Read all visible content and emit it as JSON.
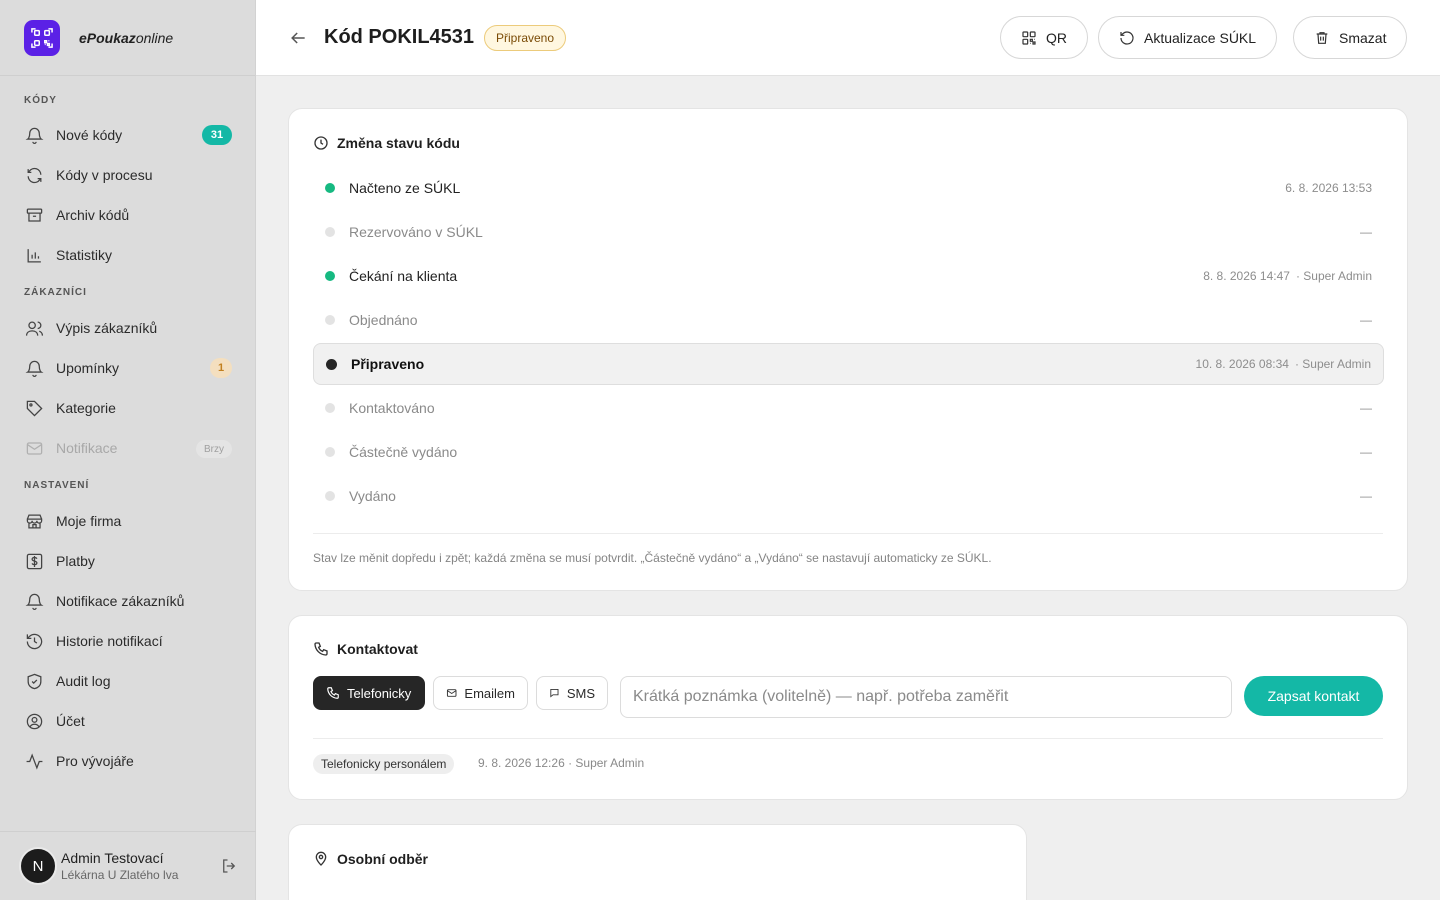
{
  "brand": {
    "name_bold": "ePoukaz",
    "name_rest": "online",
    "icon": "qr-code-icon",
    "color": "#5b21e6"
  },
  "sidebar": {
    "sections": [
      {
        "title": "KÓDY",
        "items": [
          {
            "label": "Nové kódy",
            "icon": "bell-icon",
            "badge": "31"
          },
          {
            "label": "Kódy v procesu",
            "icon": "refresh-icon"
          },
          {
            "label": "Archiv kódů",
            "icon": "archive-icon"
          },
          {
            "label": "Statistiky",
            "icon": "chart-icon"
          }
        ]
      },
      {
        "title": "ZÁKAZNÍCI",
        "items": [
          {
            "label": "Výpis zákazníků",
            "icon": "users-icon"
          },
          {
            "label": "Upomínky",
            "icon": "bell-icon",
            "badge": "1"
          },
          {
            "label": "Kategorie",
            "icon": "tag-icon"
          },
          {
            "label": "Notifikace",
            "icon": "mail-icon",
            "badge": "Brzy",
            "disabled": true
          }
        ]
      },
      {
        "title": "NASTAVENÍ",
        "items": [
          {
            "label": "Moje firma",
            "icon": "store-icon"
          },
          {
            "label": "Platby",
            "icon": "dollar-icon"
          },
          {
            "label": "Notifikace zákazníků",
            "icon": "bell-icon"
          },
          {
            "label": "Historie notifikací",
            "icon": "history-icon"
          },
          {
            "label": "Audit log",
            "icon": "shield-icon"
          },
          {
            "label": "Účet",
            "icon": "user-circle-icon"
          },
          {
            "label": "Pro vývojáře",
            "icon": "activity-icon"
          }
        ]
      }
    ]
  },
  "user": {
    "initial": "N",
    "name": "Admin Testovací",
    "pharmacy": "Lékárna U Zlatého lva"
  },
  "header": {
    "title": "Kód POKIL4531",
    "status": "Připraveno",
    "buttons": {
      "qr": "QR",
      "update": "Aktualizace SÚKL",
      "delete": "Smazat"
    }
  },
  "status_card": {
    "title": "Změna stavu kódu",
    "rows": [
      {
        "label": "Načteno ze SÚKL",
        "state": "done",
        "date": "6. 8. 2026 13:53",
        "by": ""
      },
      {
        "label": "Rezervováno v SÚKL",
        "state": "todo",
        "date": "—",
        "by": ""
      },
      {
        "label": "Čekání na klienta",
        "state": "done",
        "date": "8. 8. 2026 14:47",
        "by": "· Super Admin"
      },
      {
        "label": "Objednáno",
        "state": "todo",
        "date": "—",
        "by": ""
      },
      {
        "label": "Připraveno",
        "state": "current",
        "date": "10. 8. 2026 08:34",
        "by": "· Super Admin"
      },
      {
        "label": "Kontaktováno",
        "state": "todo",
        "date": "—",
        "by": ""
      },
      {
        "label": "Částečně vydáno",
        "state": "todo",
        "date": "—",
        "by": ""
      },
      {
        "label": "Vydáno",
        "state": "todo",
        "date": "—",
        "by": ""
      }
    ],
    "note": "Stav lze měnit dopředu i zpět; každá změna se musí potvrdit. „Částečně vydáno“ a „Vydáno“ se nastavují automaticky ze SÚKL."
  },
  "contact_card": {
    "title": "Kontaktovat",
    "methods": {
      "phone": "Telefonicky",
      "email": "Emailem",
      "sms": "SMS"
    },
    "input_placeholder": "Krátká poznámka (volitelně) — např. potřeba zaměřit",
    "submit": "Zapsat kontakt",
    "history": {
      "tag": "Telefonicky personálem",
      "meta": "9. 8. 2026 12:26 · Super Admin"
    }
  },
  "pickup_card": {
    "title": "Osobní odběr"
  },
  "colors": {
    "accent": "#14b8a6",
    "done": "#16b981",
    "warn_bg": "#fff7e0"
  }
}
